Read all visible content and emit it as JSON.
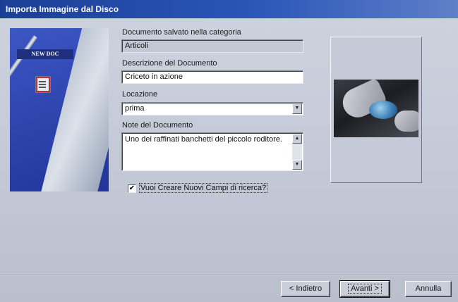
{
  "window": {
    "title": "Importa Immagine dal Disco"
  },
  "side_art": {
    "label": "NEW DOC"
  },
  "form": {
    "category_label": "Documento salvato nella categoria",
    "category_value": "Articoli",
    "description_label": "Descrizione del Documento",
    "description_value": "Criceto in azione",
    "location_label": "Locazione",
    "location_value": "prima",
    "notes_label": "Note del Documento",
    "notes_value": "Uno dei raffinati banchetti del piccolo roditore.",
    "create_fields_label": "Vuoi Creare Nuovi Campi di ricerca?",
    "create_fields_checked": true
  },
  "buttons": {
    "back": "< Indietro",
    "next": "Avanti >",
    "cancel": "Annulla"
  }
}
